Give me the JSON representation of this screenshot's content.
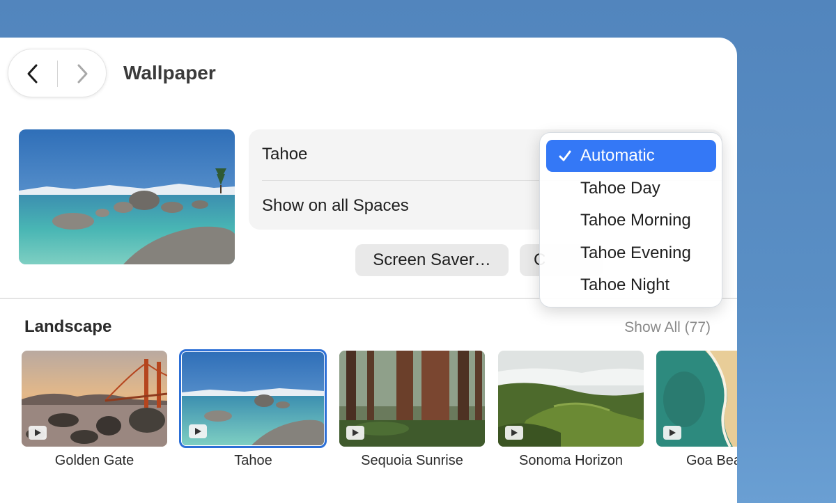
{
  "header": {
    "title": "Wallpaper"
  },
  "settings": {
    "wallpaper_name": "Tahoe",
    "spaces_label": "Show on all Spaces"
  },
  "buttons": {
    "screen_saver": "Screen Saver…",
    "other_partial": "C"
  },
  "dropdown": {
    "items": [
      {
        "label": "Automatic",
        "selected": true
      },
      {
        "label": "Tahoe Day",
        "selected": false
      },
      {
        "label": "Tahoe Morning",
        "selected": false
      },
      {
        "label": "Tahoe Evening",
        "selected": false
      },
      {
        "label": "Tahoe Night",
        "selected": false
      }
    ]
  },
  "section": {
    "title": "Landscape",
    "show_all": "Show All (77)",
    "items": [
      {
        "label": "Golden Gate"
      },
      {
        "label": "Tahoe",
        "selected": true
      },
      {
        "label": "Sequoia Sunrise"
      },
      {
        "label": "Sonoma Horizon"
      },
      {
        "label": "Goa Bea"
      }
    ]
  },
  "colors": {
    "accent": "#3478f6",
    "selection_border": "#2c6fd6",
    "desktop": "#5a8fc5"
  }
}
